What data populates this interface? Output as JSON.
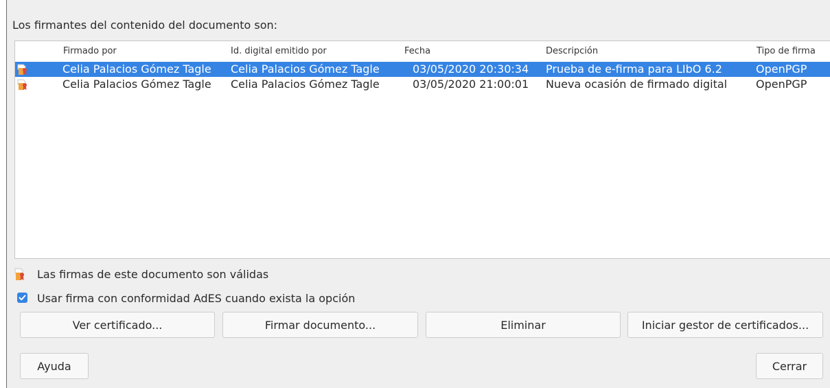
{
  "dialog": {
    "heading": "Los firmantes del contenido del documento son:"
  },
  "columns": [
    "Firmado por",
    "Id. digital emitido por",
    "Fecha",
    "Descripción",
    "Tipo de firma"
  ],
  "rows": [
    {
      "signed_by": "Celia Palacios Gómez Tagle",
      "issued_by": "Celia Palacios Gómez Tagle",
      "date": "03/05/2020 20:30:34",
      "description": "Prueba de e-firma para LIbO 6.2",
      "type": "OpenPGP",
      "selected": true,
      "icon": "certificate-icon"
    },
    {
      "signed_by": "Celia Palacios Gómez Tagle",
      "issued_by": "Celia Palacios Gómez Tagle",
      "date": "03/05/2020 21:00:01",
      "description": "Nueva ocasión de firmado digital",
      "type": "OpenPGP",
      "selected": false,
      "icon": "certificate-icon"
    }
  ],
  "status": {
    "text": "Las firmas de este documento son válidas",
    "icon": "signature-valid-icon"
  },
  "ades_option": {
    "label": "Usar firma con conformidad AdES cuando exista la opción",
    "checked": true
  },
  "buttons": {
    "view_certificate": "Ver certificado...",
    "sign_document": "Firmar documento...",
    "remove": "Eliminar",
    "cert_manager": "Iniciar gestor de certificados...",
    "help": "Ayuda",
    "close": "Cerrar"
  },
  "colors": {
    "selection": "#3584e4",
    "dialog_bg": "#efefef",
    "list_bg": "#ffffff"
  }
}
